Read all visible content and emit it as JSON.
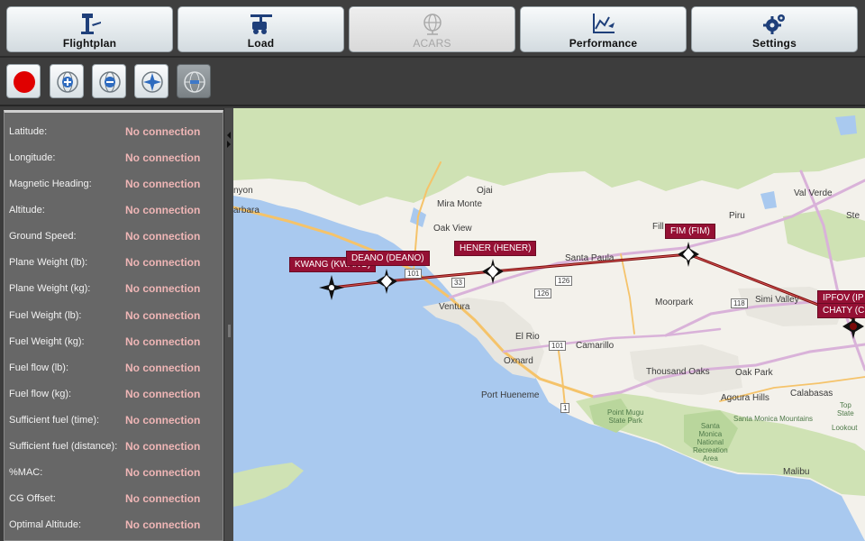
{
  "nav": {
    "flightplan": "Flightplan",
    "load": "Load",
    "acars": "ACARS",
    "performance": "Performance",
    "settings": "Settings"
  },
  "icons": {
    "flightplan": "airport-tower-icon",
    "load": "cargo-loader-icon",
    "acars": "globe-network-icon",
    "performance": "performance-chart-icon",
    "settings": "gears-icon",
    "record": "record-icon",
    "zoom_in": "zoom-in-icon",
    "zoom_out": "zoom-out-icon",
    "center": "center-position-icon",
    "layers": "map-layers-icon"
  },
  "colors": {
    "accent_red": "#e00000",
    "waypoint": "#951034",
    "route": "#7b0a0a",
    "value_text": "#efb6b6"
  },
  "sidebar": {
    "rows": [
      {
        "label": "Latitude:",
        "value": "No connection"
      },
      {
        "label": "Longitude:",
        "value": "No connection"
      },
      {
        "label": "Magnetic Heading:",
        "value": "No connection"
      },
      {
        "label": "Altitude:",
        "value": "No connection"
      },
      {
        "label": "Ground Speed:",
        "value": "No connection"
      },
      {
        "label": "Plane Weight (lb):",
        "value": "No connection"
      },
      {
        "label": "Plane Weight (kg):",
        "value": "No connection"
      },
      {
        "label": "Fuel Weight (lb):",
        "value": "No connection"
      },
      {
        "label": "Fuel Weight (kg):",
        "value": "No connection"
      },
      {
        "label": "Fuel flow (lb):",
        "value": "No connection"
      },
      {
        "label": "Fuel flow (kg):",
        "value": "No connection"
      },
      {
        "label": "Sufficient fuel (time):",
        "value": "No connection"
      },
      {
        "label": "Sufficient fuel (distance):",
        "value": "No connection"
      },
      {
        "label": "%MAC:",
        "value": "No connection"
      },
      {
        "label": "CG Offset:",
        "value": "No connection"
      },
      {
        "label": "Optimal Altitude:",
        "value": "No connection"
      }
    ]
  },
  "map": {
    "places": {
      "canyon": "nyon",
      "barbara": "arbara",
      "ojai": "Ojai",
      "mira_monte": "Mira Monte",
      "oak_view": "Oak View",
      "ventura": "Ventura",
      "el_rio": "El Rio",
      "oxnard": "Oxnard",
      "camarillo": "Camarillo",
      "port_hueneme": "Port Hueneme",
      "santa_paula": "Santa Paula",
      "fillmore": "Fill",
      "piru": "Piru",
      "val_verde": "Val Verde",
      "stevenson": "Ste",
      "moorpark": "Moorpark",
      "simi_valley": "Simi Valley",
      "thousand_oaks": "Thousand Oaks",
      "oak_park": "Oak Park",
      "agoura_hills": "Agoura Hills",
      "calabasas": "Calabasas",
      "malibu": "Malibu",
      "point_mugu": "Point Mugu\nState Park",
      "santa_monica_mountains": "Santa Monica Mountains",
      "smm_nra": "Santa\nMonica\nNational\nRecreation\nArea",
      "topanga": "Top\nState",
      "lookout": "Lookout"
    },
    "roads": {
      "r1": "1",
      "r33": "33",
      "r101a": "101",
      "r101b": "101",
      "r126a": "126",
      "r126b": "126",
      "r118": "118"
    },
    "waypoints": [
      {
        "label": "KWANG (KWANG)"
      },
      {
        "label": "DEANO (DEANO)"
      },
      {
        "label": "HENER (HENER)"
      },
      {
        "label": "FIM (FIM)"
      },
      {
        "label": "IPFOV (IP"
      },
      {
        "label": "CHATY (C"
      }
    ]
  }
}
